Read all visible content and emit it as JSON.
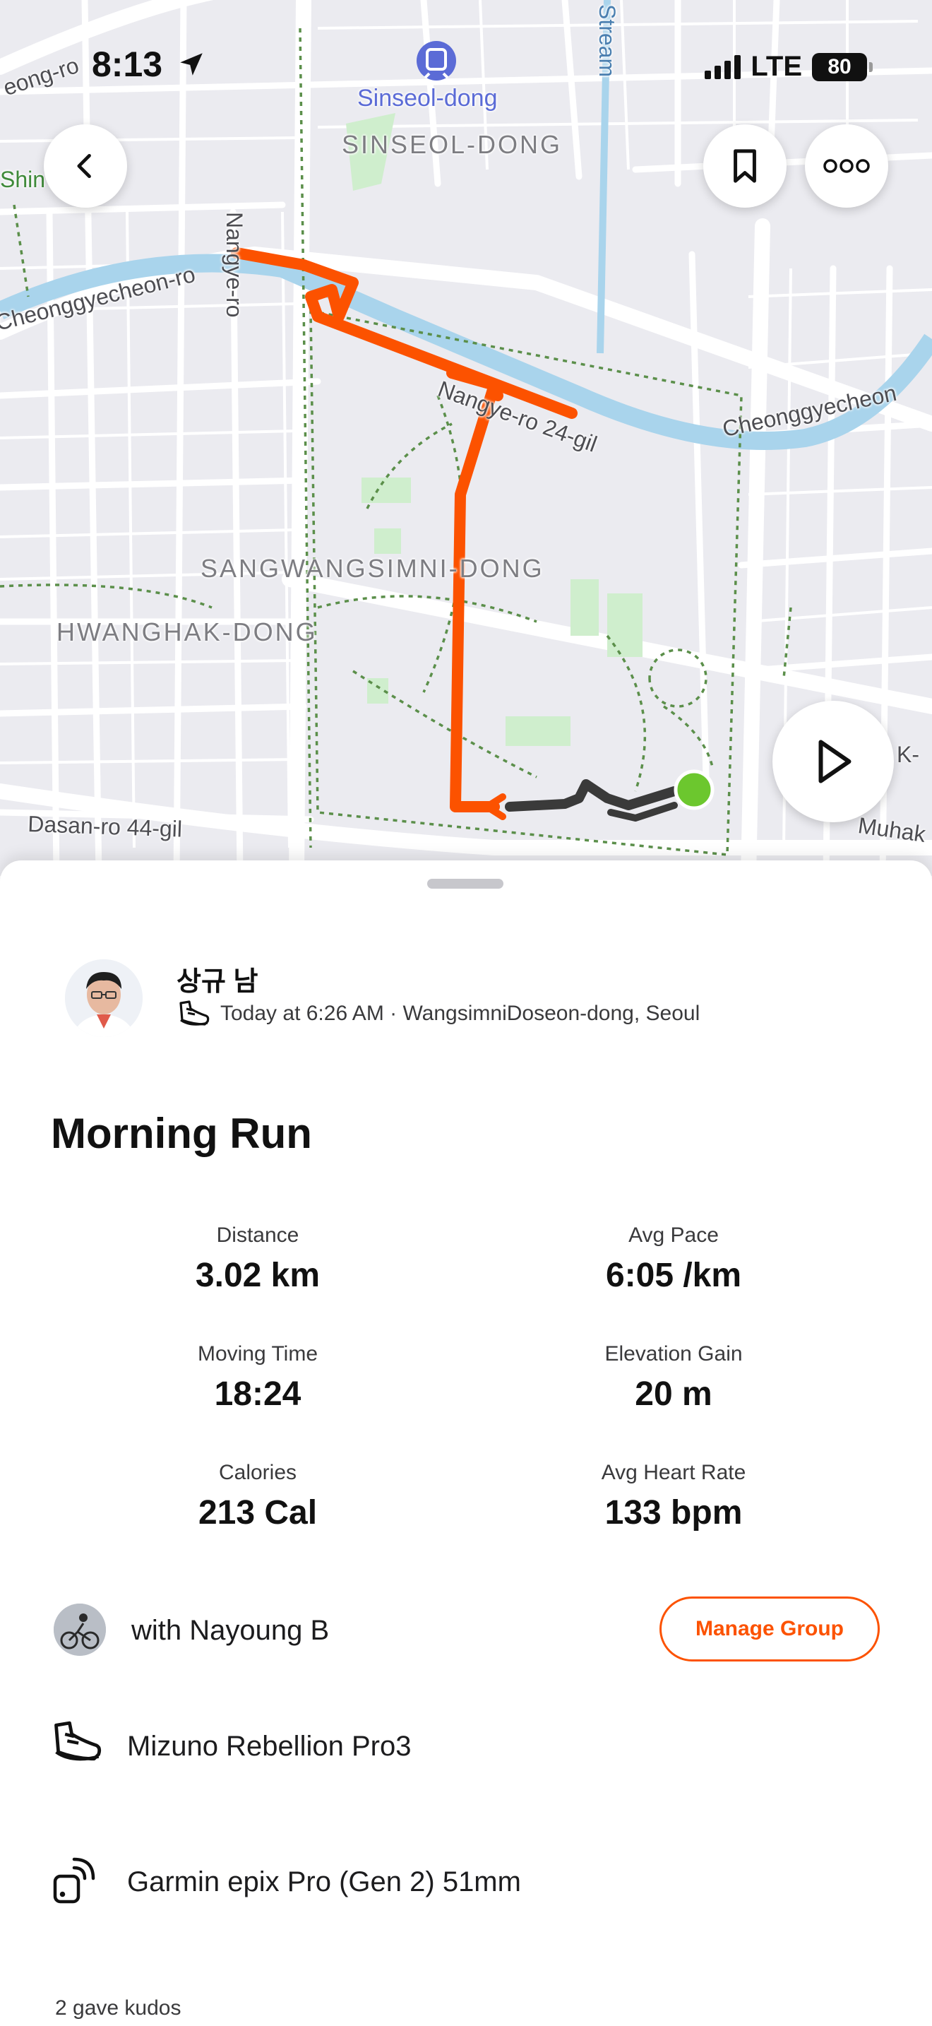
{
  "status_bar": {
    "time": "8:13",
    "network": "LTE",
    "battery": "80"
  },
  "map": {
    "transit_station": "Sinseol-dong",
    "districts": [
      "SINSEOL-DONG",
      "SANGWANGSIMNI-DONG",
      "HWANGHAK-DONG"
    ],
    "streets": [
      "Nangye-ro",
      "Cheonggyecheon-ro",
      "Cheonggyecheon",
      "Nangye-ro 24-gil",
      "Dasan-ro 44-gil",
      "Stream",
      "Shin",
      "eong-ro",
      "K-",
      "Muhak"
    ],
    "route_color": "#fc5200",
    "start_marker_color": "#6cc72e"
  },
  "activity": {
    "athlete_name": "상규 남",
    "meta": "Today at 6:26 AM · WangsimniDoseon-dong, Seoul",
    "title": "Morning Run",
    "stats": [
      {
        "label": "Distance",
        "value": "3.02 km"
      },
      {
        "label": "Avg Pace",
        "value": "6:05 /km"
      },
      {
        "label": "Moving Time",
        "value": "18:24"
      },
      {
        "label": "Elevation Gain",
        "value": "20 m"
      },
      {
        "label": "Calories",
        "value": "213 Cal"
      },
      {
        "label": "Avg Heart Rate",
        "value": "133 bpm"
      }
    ],
    "group": {
      "text": "with Nayoung B",
      "button": "Manage Group"
    },
    "gear": "Mizuno Rebellion Pro3",
    "device": "Garmin epix Pro (Gen 2) 51mm",
    "kudos": "2 gave kudos"
  },
  "colors": {
    "accent": "#fc5200",
    "water": "#a9d4ec",
    "park": "#cfeecd"
  }
}
